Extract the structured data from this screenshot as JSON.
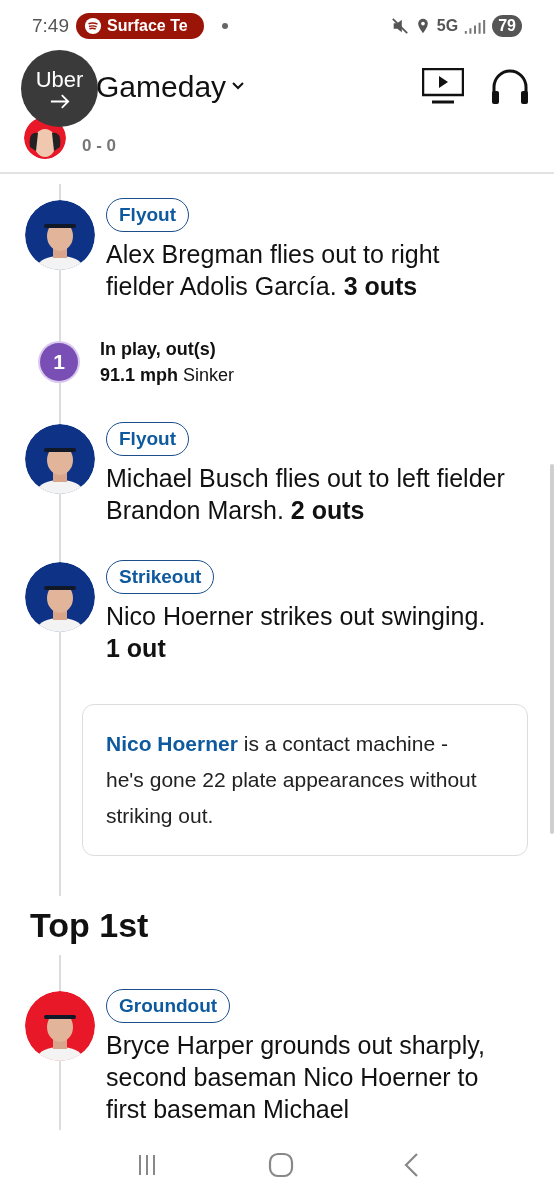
{
  "status_bar": {
    "time": "7:49",
    "media_chip": "Surface Te",
    "network": "5G",
    "battery": "79"
  },
  "header": {
    "title": "Gameday",
    "bubble_text": "Uber"
  },
  "score": "0 - 0",
  "timeline": [
    {
      "kind": "play",
      "color": "#0e3386",
      "badge": "Flyout",
      "text": "Alex Bregman flies out to right fielder Adolis García. **3 outs**"
    },
    {
      "kind": "pitch",
      "number": "1",
      "title": "In play, out(s)",
      "text": "**91.1 mph** Sinker"
    },
    {
      "kind": "play",
      "color": "#0e3386",
      "badge": "Flyout",
      "text": "Michael Busch flies out to left fielder Brandon Marsh. **2 outs**"
    },
    {
      "kind": "play",
      "color": "#0e3386",
      "badge": "Strikeout",
      "text": "Nico Hoerner strikes out swinging. **1 out**"
    },
    {
      "kind": "note",
      "link": "Nico Hoerner",
      "text": " is a contact machine - he's gone 22 plate appearances without striking out."
    },
    {
      "kind": "inning",
      "title": "Top 1st"
    },
    {
      "kind": "play",
      "color": "#e81828",
      "badge": "Groundout",
      "text": "Bryce Harper grounds out sharply, second baseman Nico Hoerner to first baseman Michael"
    }
  ]
}
